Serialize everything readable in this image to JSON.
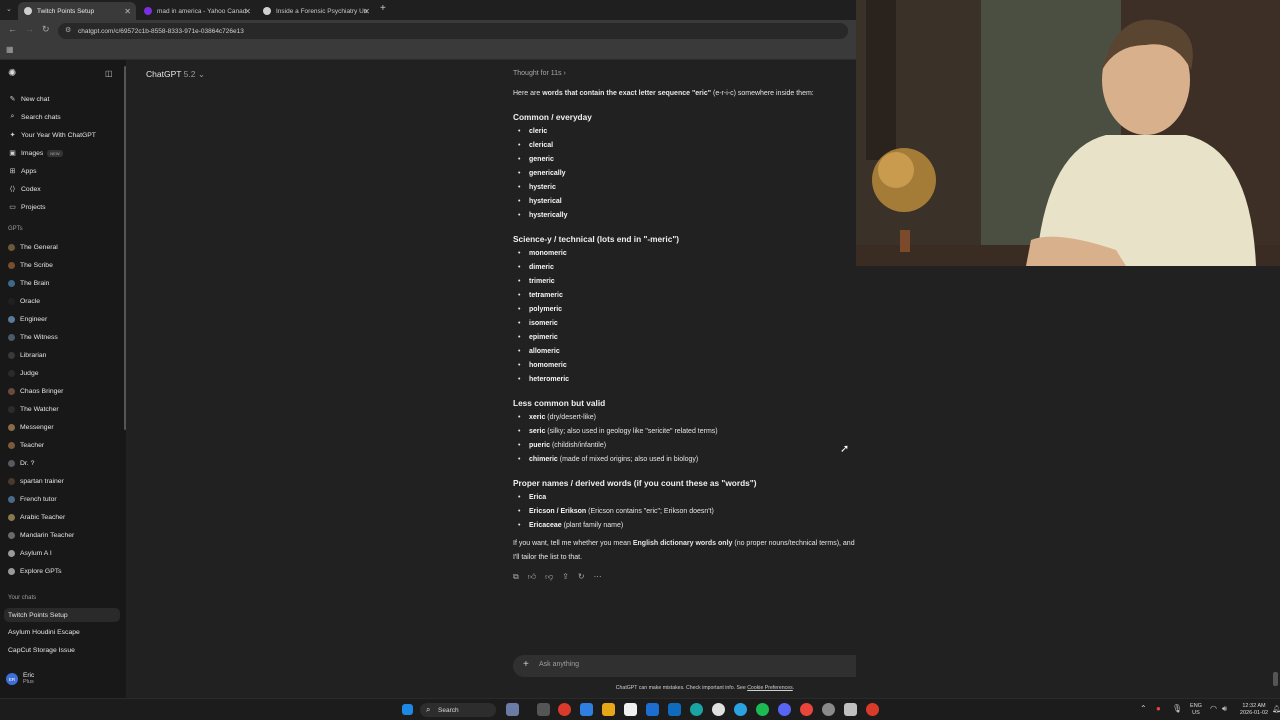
{
  "browser": {
    "tabs": [
      {
        "title": "Twitch Points Setup",
        "active": true,
        "favicon_color": "#cfcfcf"
      },
      {
        "title": "mad in america - Yahoo Canad",
        "active": false,
        "favicon_color": "#7b2fe0"
      },
      {
        "title": "Inside a Forensic Psychiatry Un",
        "active": false,
        "favicon_color": "#d0d0d0"
      }
    ],
    "new_tab": "+",
    "url": "chatgpt.com/c/69572c1b-8558-8333-971e-03864c726e13"
  },
  "sidebar": {
    "top_items": [
      {
        "label": "New chat",
        "icon": "edit-icon"
      },
      {
        "label": "Search chats",
        "icon": "search-icon"
      },
      {
        "label": "Your Year With ChatGPT",
        "icon": "sparkle-icon"
      },
      {
        "label": "Images",
        "icon": "image-icon",
        "badge": "NEW"
      },
      {
        "label": "Apps",
        "icon": "apps-icon"
      },
      {
        "label": "Codex",
        "icon": "code-icon"
      },
      {
        "label": "Projects",
        "icon": "folder-icon"
      }
    ],
    "gpts_label": "GPTs",
    "gpts": [
      {
        "label": "The General",
        "color": "#6b5a3a"
      },
      {
        "label": "The Scribe",
        "color": "#7a4d2c"
      },
      {
        "label": "The Brain",
        "color": "#3e6a8a"
      },
      {
        "label": "Oracle",
        "color": "#202020"
      },
      {
        "label": "Engineer",
        "color": "#5a7a9a"
      },
      {
        "label": "The Witness",
        "color": "#4a5a6a"
      },
      {
        "label": "Librarian",
        "color": "#3a3a3a"
      },
      {
        "label": "Judge",
        "color": "#2a2a2a"
      },
      {
        "label": "Chaos Bringer",
        "color": "#6a4a3a"
      },
      {
        "label": "The Watcher",
        "color": "#2c2c2c"
      },
      {
        "label": "Messenger",
        "color": "#8a6a4a"
      },
      {
        "label": "Teacher",
        "color": "#7a5a3a"
      },
      {
        "label": "Dr. ?",
        "color": "#5a5a5a"
      },
      {
        "label": "spartan trainer",
        "color": "#4a3a2a"
      },
      {
        "label": "French tutor",
        "color": "#4a6a8a"
      },
      {
        "label": "Arabic Teacher",
        "color": "#8a7a4a"
      },
      {
        "label": "Mandarin Teacher",
        "color": "#6a6a6a"
      },
      {
        "label": "Asylum A I",
        "color": "#9a9a9a"
      },
      {
        "label": "Explore GPTs",
        "color": "#9a9a9a"
      }
    ],
    "chats_label": "Your chats",
    "chats": [
      "Twitch Points Setup",
      "Asylum Houdini Escape",
      "CapCut Storage Issue"
    ],
    "user": {
      "name": "Eric",
      "plan": "Plus",
      "initials": "ER"
    }
  },
  "main": {
    "model": "ChatGPT",
    "model_version": "5.2",
    "thought": "Thought for 11s",
    "intro_pre": "Here are ",
    "intro_bold": "words that contain the exact letter sequence \"eric\"",
    "intro_post": " (e-r-i-c) somewhere inside them:",
    "sections": [
      {
        "heading": "Common / everyday",
        "items": [
          {
            "word": "cleric",
            "note": ""
          },
          {
            "word": "clerical",
            "note": ""
          },
          {
            "word": "generic",
            "note": ""
          },
          {
            "word": "generically",
            "note": ""
          },
          {
            "word": "hysteric",
            "note": ""
          },
          {
            "word": "hysterical",
            "note": ""
          },
          {
            "word": "hysterically",
            "note": ""
          }
        ]
      },
      {
        "heading": "Science-y / technical (lots end in \"-meric\")",
        "items": [
          {
            "word": "monomeric",
            "note": ""
          },
          {
            "word": "dimeric",
            "note": ""
          },
          {
            "word": "trimeric",
            "note": ""
          },
          {
            "word": "tetrameric",
            "note": ""
          },
          {
            "word": "polymeric",
            "note": ""
          },
          {
            "word": "isomeric",
            "note": ""
          },
          {
            "word": "epimeric",
            "note": ""
          },
          {
            "word": "allomeric",
            "note": ""
          },
          {
            "word": "homomeric",
            "note": ""
          },
          {
            "word": "heteromeric",
            "note": ""
          }
        ]
      },
      {
        "heading": "Less common but valid",
        "items": [
          {
            "word": "xeric",
            "note": " (dry/desert-like)"
          },
          {
            "word": "seric",
            "note": " (silky; also used in geology like \"sericite\" related terms)"
          },
          {
            "word": "pueric",
            "note": " (childish/infantile)"
          },
          {
            "word": "chimeric",
            "note": " (made of mixed origins; also used in biology)"
          }
        ]
      },
      {
        "heading": "Proper names / derived words (if you count these as \"words\")",
        "items": [
          {
            "word": "Erica",
            "note": ""
          },
          {
            "word": "Ericson / Erikson",
            "note": " (Ericson contains \"eric\"; Erikson doesn't)"
          },
          {
            "word": "Ericaceae",
            "note": " (plant family name)"
          }
        ]
      }
    ],
    "outro_pre": "If you want, tell me whether you mean ",
    "outro_bold": "English dictionary words only",
    "outro_post": " (no proper nouns/technical terms), and",
    "outro_line2": "I'll tailor the list to that.",
    "composer_placeholder": "Ask anything",
    "disclaimer_pre": "ChatGPT can make mistakes. Check important info. See ",
    "disclaimer_link": "Cookie Preferences",
    "disclaimer_post": "."
  },
  "taskbar": {
    "search": "Search",
    "lang_top": "ENG",
    "lang_bottom": "US",
    "time": "12:32 AM",
    "date": "2026-01-02"
  }
}
